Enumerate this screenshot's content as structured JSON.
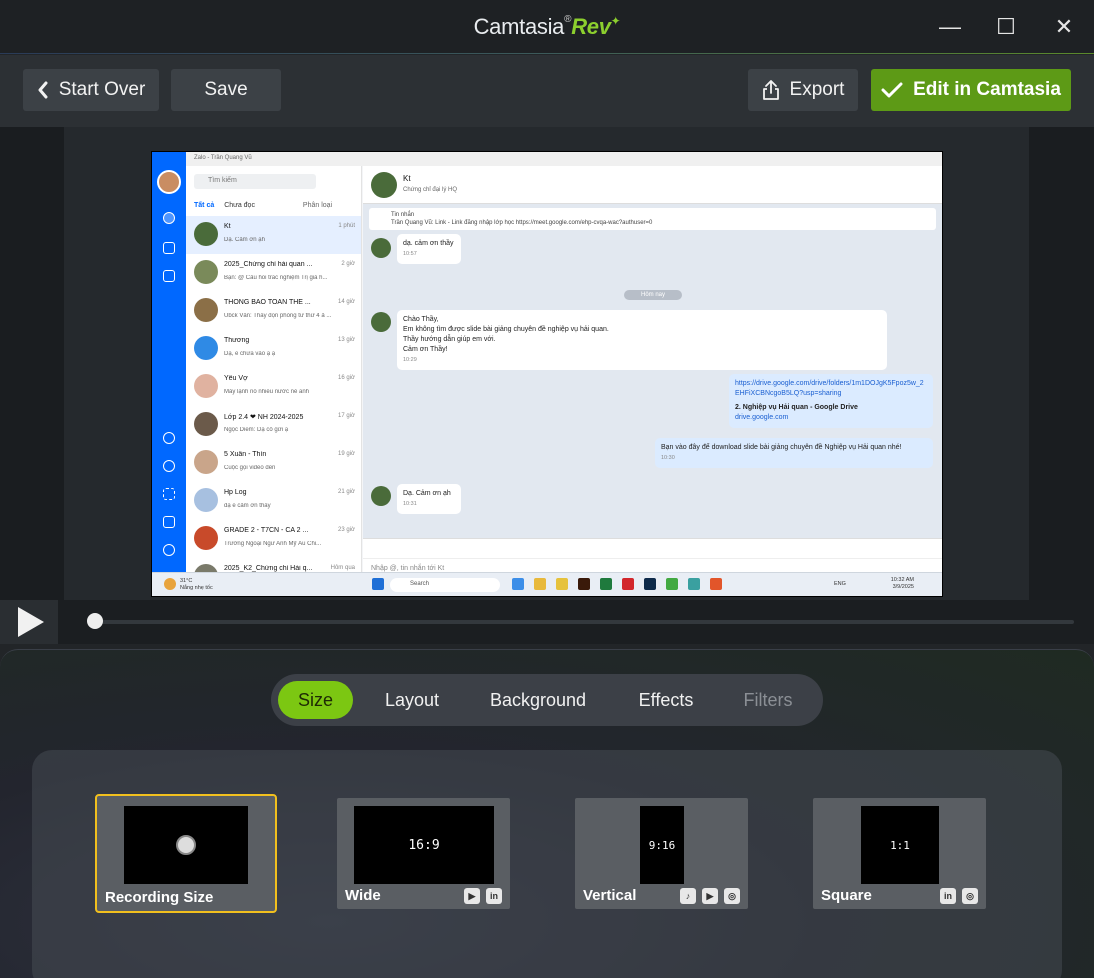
{
  "window": {
    "title_main": "Camtasia",
    "title_accent": "Rev",
    "title_reg": "®",
    "title_spark": "✦",
    "controls": {
      "minimize": "—",
      "maximize": "☐",
      "close": "✕"
    }
  },
  "toolbar": {
    "start_over": "Start Over",
    "save": "Save",
    "export": "Export",
    "edit_in_camtasia": "Edit in Camtasia"
  },
  "recording": {
    "app_title": "Zalo - Trần Quang Vũ",
    "search_placeholder": "Tìm kiếm",
    "tab_all": "Tất cả",
    "tab_unread": "Chưa đọc",
    "tab_classify": "Phân loại",
    "conversations": [
      {
        "name": "Kt",
        "msg": "Dạ. Cảm ơn ạh",
        "time": "1 phút",
        "color": "#4a6b3a"
      },
      {
        "name": "2025_Chứng chỉ hải quan ...",
        "msg": "Bạn: @ Câu hỏi trắc nghiệm Trị giá h...",
        "time": "2 giờ",
        "color": "#7a8a5a"
      },
      {
        "name": "THÔNG BÁO TOÀN THỂ ...",
        "msg": "Ubck Vân: Thầy dọn phòng tư thứ 4 ả ...",
        "time": "14 giờ",
        "color": "#8b6f47"
      },
      {
        "name": "Thương",
        "msg": "Dạ, e chưa vào ạ ạ",
        "time": "13 giờ",
        "color": "#2f8ae5"
      },
      {
        "name": "Yêu Vợ",
        "msg": "Máy lạnh nó nhiều nước nè anh",
        "time": "16 giờ",
        "color": "#e0b2a0"
      },
      {
        "name": "Lớp 2.4 ❤ NH 2024-2025",
        "msg": "Ngọc Diễm: Dạ cô gửi ạ",
        "time": "17 giờ",
        "color": "#6b5a4a"
      },
      {
        "name": "5 Xuân - Thìn",
        "msg": "Cuộc gọi video đến",
        "time": "19 giờ",
        "color": "#c9a58a"
      },
      {
        "name": "Hp Log",
        "msg": "dạ e cảm ơn thầy",
        "time": "21 giờ",
        "color": "#a7c0e0"
      },
      {
        "name": "GRADE 2 - T7CN - CA 2 ...",
        "msg": "Trường Ngoại Ngữ Anh Mỹ Âu Chi...",
        "time": "23 giờ",
        "color": "#c84a2a"
      },
      {
        "name": "2025_K2_Chứng chỉ Hải q...",
        "msg": "",
        "time": "Hôm qua",
        "color": "#7a7a6a"
      }
    ],
    "chat_name": "Kt",
    "chat_sub": "Chứng chỉ đại lý HQ",
    "pinned_title": "Tin nhắn",
    "pinned_text": "Trần Quang Vũ: Link - Link đăng nhập lớp học https://meet.google.com/ehp-cvqa-wac?authuser=0",
    "msg1": "dạ. cảm ơn thầy",
    "msg1_time": "10:57",
    "day_sep": "Hôm nay",
    "msg2_a": "Chào Thầy,",
    "msg2_b": "Em không tìm được slide bài giảng chuyên đề nghiệp vụ hải quan.",
    "msg2_c": "Thầy hướng dẫn giúp em với.",
    "msg2_d": "Cảm ơn Thầy!",
    "msg2_time": "10:29",
    "link_url": "https://drive.google.com/drive/folders/1m1DOJgK5Fpoz5w_2EHFiXCBNcgoB5LQ?usp=sharing",
    "link_title": "2. Nghiệp vụ Hải quan - Google Drive",
    "link_domain": "drive.google.com",
    "msg3": "Bạn vào đây để download slide bài giảng chuyên đề Nghiệp vụ Hải quan nhé!",
    "msg3_time": "10:30",
    "msg4": "Dạ. Cảm ơn ạh",
    "msg4_time": "10:31",
    "input_placeholder": "Nhập @, tin nhắn tới Kt",
    "taskbar_search": "Search",
    "weather": "31°C",
    "weather_sub": "Nắng nhẹ tốc",
    "lang": "ENG",
    "clock_time": "10:32 AM",
    "clock_date": "3/9/2025"
  },
  "player": {
    "progress": 0.0
  },
  "panel": {
    "tabs": [
      "Size",
      "Layout",
      "Background",
      "Effects",
      "Filters"
    ],
    "active_tab": "Size",
    "options": [
      {
        "label": "Recording Size",
        "ratio": "",
        "icons": []
      },
      {
        "label": "Wide",
        "ratio": "16:9",
        "icons": [
          "YouTube",
          "LinkedIn"
        ]
      },
      {
        "label": "Vertical",
        "ratio": "9:16",
        "icons": [
          "TikTok",
          "YouTube",
          "Instagram"
        ]
      },
      {
        "label": "Square",
        "ratio": "1:1",
        "icons": [
          "LinkedIn",
          "Instagram"
        ]
      }
    ]
  },
  "colors": {
    "accent_green": "#7cc712",
    "edit_button": "#5d9a16",
    "selection": "#f2c01e"
  }
}
